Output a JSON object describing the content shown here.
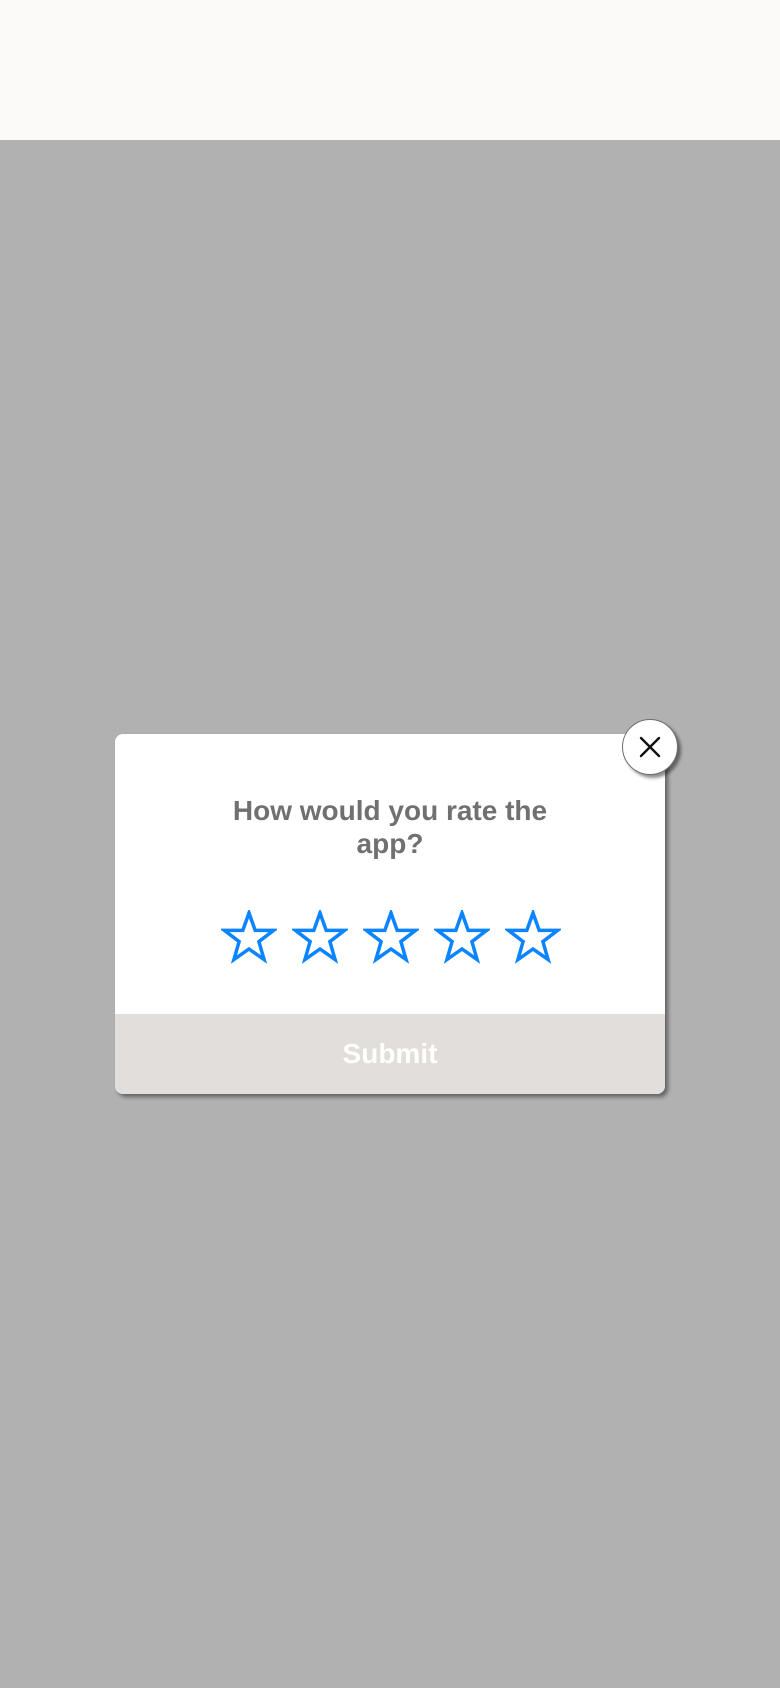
{
  "rating_dialog": {
    "question": "How would you rate the app?",
    "submit_label": "Submit",
    "close_icon": "close-icon",
    "star_icon": "star-outline-icon",
    "star_count": 5,
    "selected_rating": 0
  },
  "colors": {
    "overlay": "#b1b1b1",
    "top_bar": "#fbfaf9",
    "dialog_background": "#ffffff",
    "question_text": "#707070",
    "star_outline": "#0a84ff",
    "submit_background": "#e2dedc",
    "submit_text": "#ffffff"
  }
}
